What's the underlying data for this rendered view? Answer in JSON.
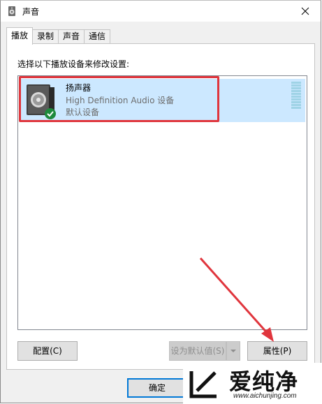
{
  "window": {
    "title": "声音"
  },
  "tabs": [
    {
      "label": "播放"
    },
    {
      "label": "录制"
    },
    {
      "label": "声音"
    },
    {
      "label": "通信"
    }
  ],
  "playback": {
    "instruction": "选择以下播放设备来修改设置:",
    "devices": [
      {
        "name": "扬声器",
        "description": "High Definition Audio 设备",
        "status": "默认设备",
        "selected": true,
        "is_default": true
      }
    ]
  },
  "buttons": {
    "configure": "配置(C)",
    "set_default": "设为默认值(S)",
    "properties": "属性(P)",
    "ok": "确定"
  },
  "watermark": {
    "brand": "爱纯净",
    "url": "www.aichunjing.com"
  },
  "colors": {
    "selection": "#cce8ff",
    "highlight": "#e0353d",
    "accent": "#0078d7"
  }
}
